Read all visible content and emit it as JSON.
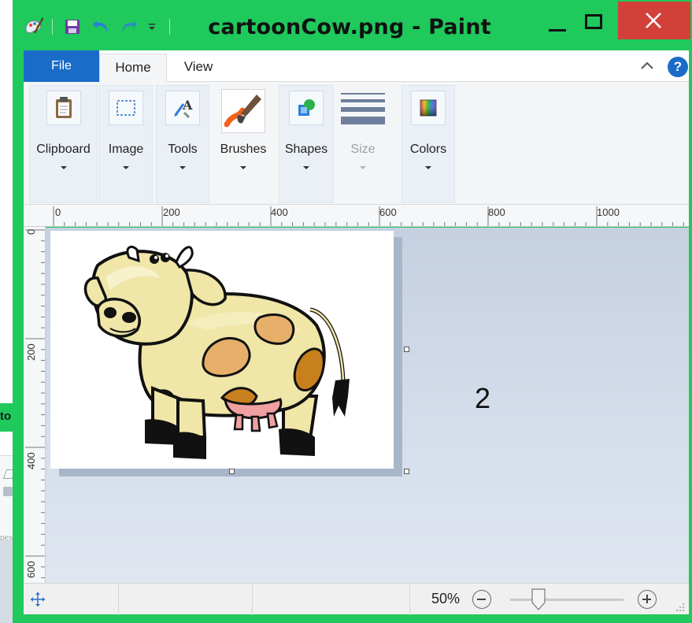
{
  "window": {
    "title": "cartoonCow.png - Paint",
    "frame_color": "#1fc95c",
    "close_color": "#d3403a"
  },
  "quick_access": {
    "icons": [
      "paint-icon",
      "save-icon",
      "undo-icon",
      "redo-icon",
      "customize-quick-access-icon"
    ]
  },
  "tabs": {
    "file": "File",
    "home": "Home",
    "view": "View",
    "file_color": "#1a6cc8"
  },
  "ribbon": {
    "groups": [
      {
        "label": "Clipboard",
        "icon": "clipboard-icon",
        "enabled": true
      },
      {
        "label": "Image",
        "icon": "select-image-icon",
        "enabled": true
      },
      {
        "label": "Tools",
        "icon": "tools-icon",
        "enabled": true
      },
      {
        "label": "Brushes",
        "icon": "brushes-icon",
        "enabled": true
      },
      {
        "label": "Shapes",
        "icon": "shapes-icon",
        "enabled": true
      },
      {
        "label": "Size",
        "icon": "size-icon",
        "enabled": false
      },
      {
        "label": "Colors",
        "icon": "colors-icon",
        "enabled": true
      }
    ],
    "help": "?"
  },
  "ruler": {
    "horizontal": [
      "0",
      "200",
      "400",
      "600",
      "800",
      "1000"
    ],
    "vertical": [
      "0",
      "200",
      "400",
      "600"
    ]
  },
  "canvas": {
    "image": "cartoon cow",
    "annotation": "2"
  },
  "statusbar": {
    "zoom_level": "50%",
    "zoom_fraction": 0.25
  },
  "background_window": {
    "title_fragment": "to",
    "label_fragment": "pes"
  }
}
